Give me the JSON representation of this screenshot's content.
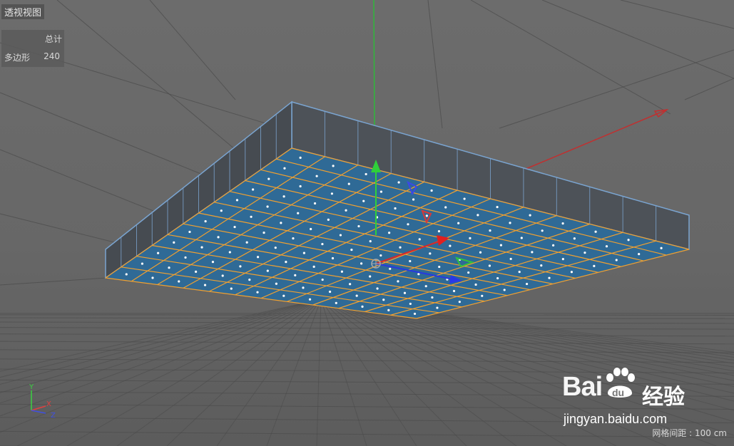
{
  "viewport": {
    "title": "透视视图",
    "stats": {
      "header": "总计",
      "label": "多边形",
      "value": "240"
    },
    "grid_spacing": "网格间距 : 100 cm"
  },
  "axis_labels": {
    "y": "Y",
    "x": "X",
    "z": "Z"
  },
  "watermark": {
    "brand_latin": "Bai",
    "brand_du": "du",
    "brand_cn": "经验",
    "url": "jingyan.baidu.com"
  },
  "colors": {
    "background": "#666666",
    "grid_line": "#4a4a4a",
    "face_fill": "#2f6a96",
    "face_edge": "#f0a030",
    "side_fill": "#4d5258",
    "outline": "#7aa4d0",
    "axis_x": "#d03030",
    "axis_y": "#30c030",
    "axis_z": "#3040e0"
  },
  "icons": [
    "move-gizmo-icon",
    "axis-orientation-icon",
    "baidu-paw-icon"
  ]
}
